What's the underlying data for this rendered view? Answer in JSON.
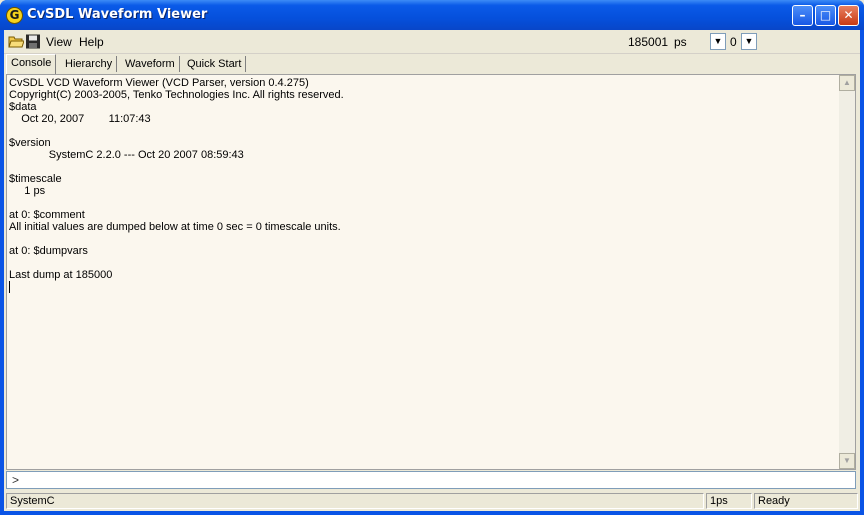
{
  "window": {
    "title": "CvSDL Waveform Viewer",
    "icon": "cvsdl-logo-icon",
    "controls": {
      "minimize": "minimize-icon",
      "maximize": "maximize-icon",
      "close": "close-icon"
    }
  },
  "toolbar": {
    "open_icon": "folder-open-icon",
    "save_icon": "floppy-disk-icon",
    "menu": [
      {
        "label": "View"
      },
      {
        "label": "Help"
      }
    ],
    "time_value": "185001",
    "time_unit": "ps",
    "combo_value": "0"
  },
  "tabs": [
    {
      "label": "Console",
      "active": true
    },
    {
      "label": "Hierarchy",
      "active": false
    },
    {
      "label": "Waveform",
      "active": false
    },
    {
      "label": "Quick Start",
      "active": false
    }
  ],
  "console": {
    "lines": [
      "CvSDL VCD Waveform Viewer (VCD Parser, version 0.4.275)",
      "Copyright(C) 2003-2005, Tenko Technologies Inc. All rights reserved.",
      "$data",
      "    Oct 20, 2007        11:07:43",
      "",
      "$version",
      "             SystemC 2.2.0 --- Oct 20 2007 08:59:43",
      "",
      "$timescale",
      "     1 ps",
      "",
      "at 0: $comment",
      "All initial values are dumped below at time 0 sec = 0 timescale units.",
      "",
      "at 0: $dumpvars",
      "",
      "Last dump at 185000"
    ]
  },
  "command": {
    "prompt": ">",
    "value": ""
  },
  "status": {
    "left": "SystemC",
    "scale": "1ps",
    "state": "Ready"
  }
}
